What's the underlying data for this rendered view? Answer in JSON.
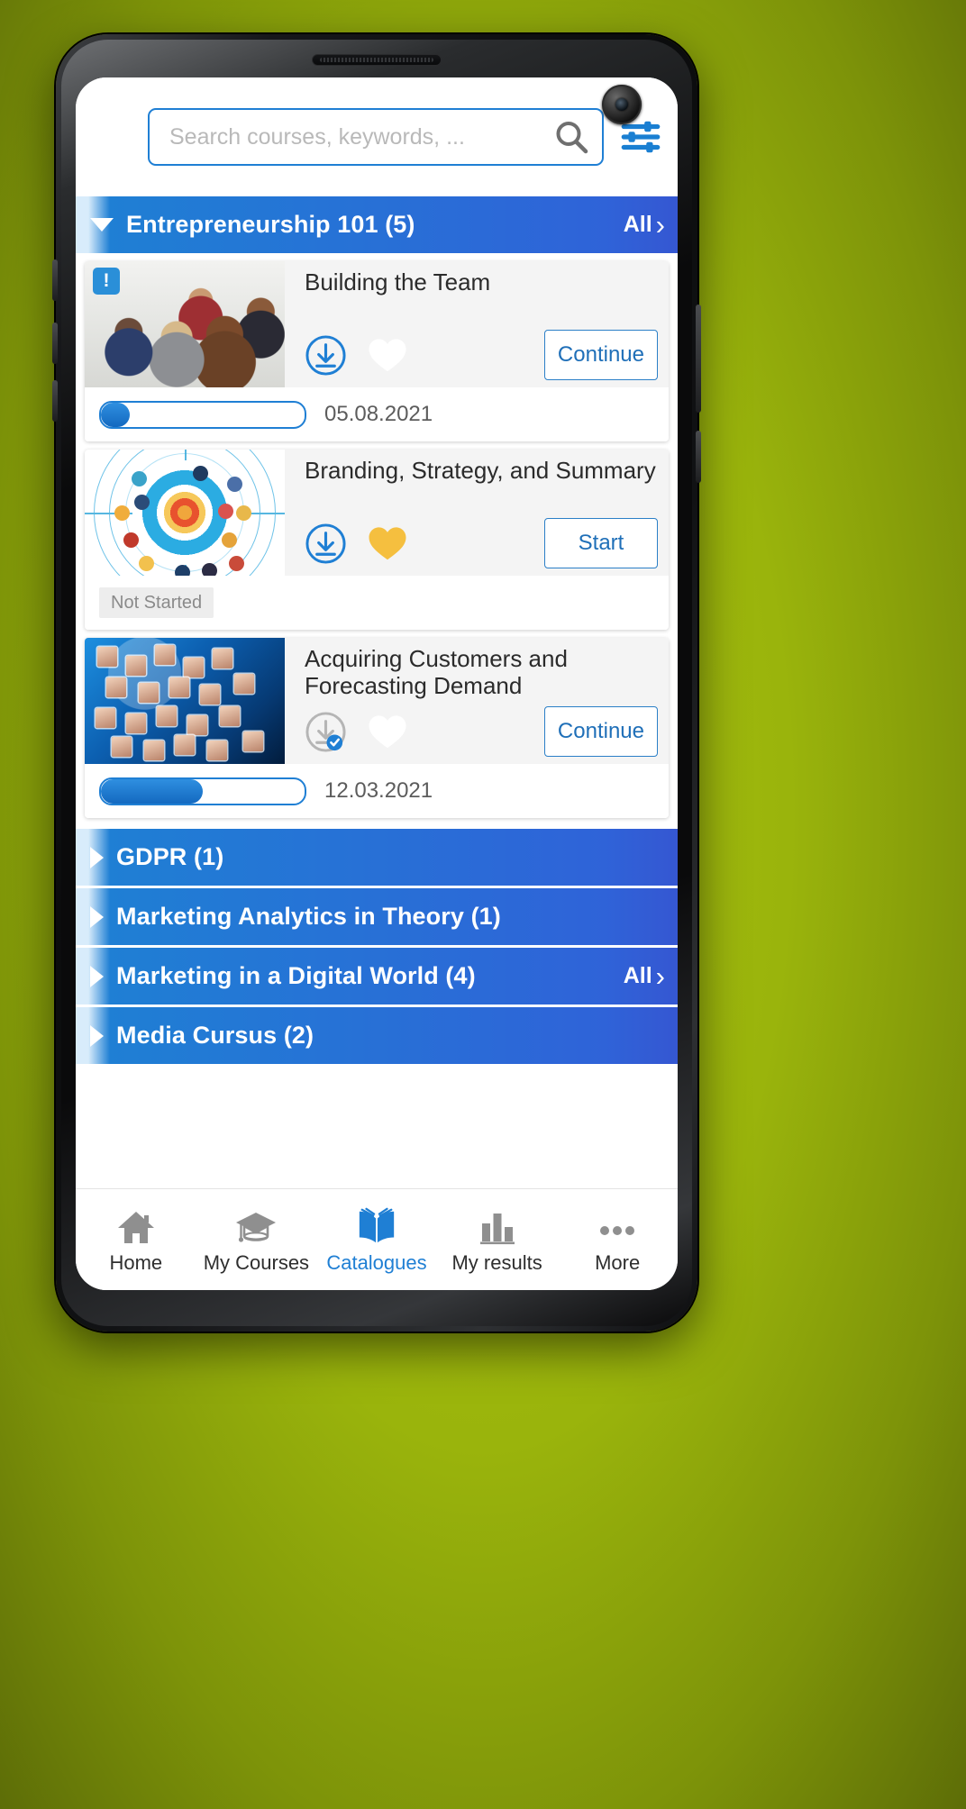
{
  "colors": {
    "background": "#a0b90d",
    "accent_blue": "#1f7fd4",
    "header_blue_start": "#1f7fd4",
    "header_blue_end": "#3557d2",
    "heart_active": "#f5bf3f",
    "card_bg": "#f4f4f4"
  },
  "search": {
    "placeholder": "Search courses, keywords, ...",
    "value": "",
    "icon": "search-icon",
    "filter_icon": "sliders-filter-icon"
  },
  "sections": [
    {
      "title": "Entrepreneurship 101 (5)",
      "expanded": true,
      "arrow": "triangle-down-icon",
      "all_label": "All",
      "all_chevron": "chevron-right-icon",
      "courses": [
        {
          "title": "Building the Team",
          "thumb": "team-meeting-photo",
          "badge": "!",
          "download_icon": "download-circle-icon",
          "download_state": "available",
          "favorite_icon": "heart-icon",
          "favorite": false,
          "cta": "Continue",
          "progress": 14,
          "date": "05.08.2021",
          "status": ""
        },
        {
          "title": "Branding, Strategy, and Summary",
          "thumb": "target-bullseye-illustration",
          "badge": "",
          "download_icon": "download-circle-icon",
          "download_state": "available",
          "favorite_icon": "heart-icon",
          "favorite": true,
          "cta": "Start",
          "progress": 0,
          "date": "",
          "status": "Not Started"
        },
        {
          "title": "Acquiring Customers and Forecasting Demand",
          "thumb": "people-network-photo",
          "badge": "",
          "download_icon": "download-circle-check-icon",
          "download_state": "downloaded",
          "favorite_icon": "heart-icon",
          "favorite": false,
          "cta": "Continue",
          "progress": 50,
          "date": "12.03.2021",
          "status": ""
        }
      ]
    },
    {
      "title": "GDPR (1)",
      "expanded": false,
      "arrow": "triangle-right-icon",
      "all_label": "",
      "all_chevron": "",
      "courses": []
    },
    {
      "title": "Marketing Analytics in Theory (1)",
      "expanded": false,
      "arrow": "triangle-right-icon",
      "all_label": "",
      "all_chevron": "",
      "courses": []
    },
    {
      "title": "Marketing in a Digital World (4)",
      "expanded": false,
      "arrow": "triangle-right-icon",
      "all_label": "All",
      "all_chevron": "chevron-right-icon",
      "courses": []
    },
    {
      "title": "Media Cursus (2)",
      "expanded": false,
      "arrow": "triangle-right-icon",
      "all_label": "",
      "all_chevron": "",
      "courses": []
    }
  ],
  "bottom_nav": {
    "active_index": 2,
    "items": [
      {
        "label": "Home",
        "icon": "home-icon"
      },
      {
        "label": "My Courses",
        "icon": "graduation-cap-icon"
      },
      {
        "label": "Catalogues",
        "icon": "open-book-icon"
      },
      {
        "label": "My results",
        "icon": "bar-chart-icon"
      },
      {
        "label": "More",
        "icon": "ellipsis-icon"
      }
    ]
  }
}
